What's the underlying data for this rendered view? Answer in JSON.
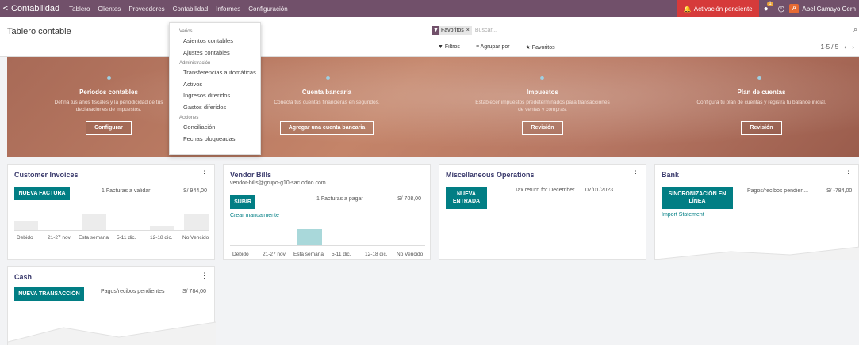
{
  "nav": {
    "back": "<",
    "app": "Contabilidad",
    "menus": [
      "Tablero",
      "Clientes",
      "Proveedores",
      "Contabilidad",
      "Informes",
      "Configuración"
    ],
    "activation": "Activación pendiente",
    "messages_count": "1",
    "user_initial": "A",
    "user_name": "Abel Camayo Cern"
  },
  "control": {
    "title": "Tablero contable",
    "facet_label": "Favoritos",
    "facet_close": "×",
    "search_placeholder": "Buscar...",
    "filters": "Filtros",
    "group_by": "Agrupar por",
    "favorites": "Favoritos",
    "pager": "1-5 / 5"
  },
  "dropdown": {
    "sections": [
      {
        "header": "Varios",
        "items": [
          "Asientos contables",
          "Ajustes contables"
        ]
      },
      {
        "header": "Administración",
        "items": [
          "Transferencias automáticas",
          "Activos",
          "Ingresos diferidos",
          "Gastos diferidos"
        ]
      },
      {
        "header": "Acciones",
        "items": [
          "Conciliación",
          "Fechas bloqueadas"
        ]
      }
    ]
  },
  "banner": {
    "steps": [
      {
        "title": "Periodos contables",
        "desc": "Defina tus años fiscales y la periodicidad de tus declaraciones de impuestos.",
        "button": "Configurar"
      },
      {
        "title": "Cuenta bancaria",
        "desc": "Conecta tus cuentas financieras en segundos.",
        "button": "Agregar una cuenta bancaria"
      },
      {
        "title": "Impuestos",
        "desc": "Establecer impuestos predeterminados para transacciones de ventas y compras.",
        "button": "Revisión"
      },
      {
        "title": "Plan de cuentas",
        "desc": "Configura tu plan de cuentas y registra tu balance inicial.",
        "button": "Revisión"
      }
    ]
  },
  "cards": {
    "customer_invoices": {
      "title": "Customer Invoices",
      "menu": "⋮",
      "button": "NUEVA FACTURA",
      "info": "1 Facturas a validar",
      "amount": "S/ 944,00",
      "axis": [
        "Debido",
        "21-27 nov.",
        "Esta semana",
        "5-11 dic.",
        "12-18 dic.",
        "No Vencido"
      ]
    },
    "vendor_bills": {
      "title": "Vendor Bills",
      "menu": "⋮",
      "email": "vendor-bills@grupo-g10-sac.odoo.com",
      "button": "SUBIR",
      "info": "1 Facturas a pagar",
      "amount": "S/ 708,00",
      "link": "Crear manualmente",
      "axis": [
        "Debido",
        "21-27 nov.",
        "Esta semana",
        "5-11 dic.",
        "12-18 dic.",
        "No Vencido"
      ]
    },
    "misc": {
      "title": "Miscellaneous Operations",
      "menu": "⋮",
      "button_line1": "NUEVA",
      "button_line2": "ENTRADA",
      "info": "Tax return for December",
      "date": "07/01/2023"
    },
    "bank": {
      "title": "Bank",
      "menu": "⋮",
      "button_line1": "SINCRONIZACIÓN EN",
      "button_line2": "LÍNEA",
      "info": "Pagos/recibos pendien...",
      "amount": "S/ -784,00",
      "link": "Import Statement"
    },
    "cash": {
      "title": "Cash",
      "menu": "⋮",
      "button": "NUEVA TRANSACCIÓN",
      "info": "Pagos/recibos pendientes",
      "amount": "S/ 784,00"
    }
  },
  "colors": {
    "nav": "#71506a",
    "teal": "#017e84",
    "alert": "#d63a3a"
  }
}
